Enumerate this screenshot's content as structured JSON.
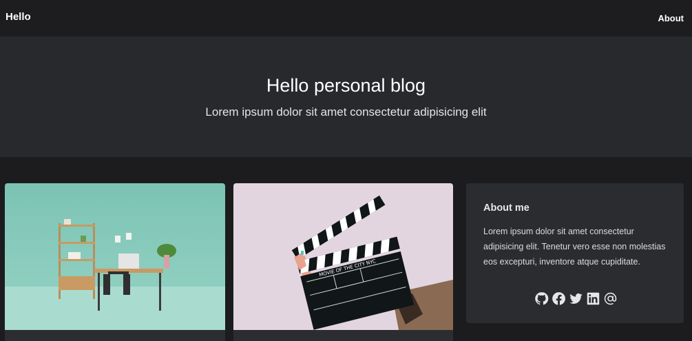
{
  "navbar": {
    "brand": "Hello",
    "about": "About"
  },
  "hero": {
    "title": "Hello personal blog",
    "subtitle": "Lorem ipsum dolor sit amet consectetur adipisicing elit"
  },
  "sidebar": {
    "title": "About me",
    "text": "Lorem ipsum dolor sit amet consectetur adipisicing elit. Tenetur vero esse non molestias eos excepturi, inventore atque cupiditate.",
    "social_icons": [
      "github-icon",
      "facebook-icon",
      "twitter-icon",
      "linkedin-icon",
      "email-icon"
    ]
  },
  "cards": [
    {
      "image": "home-office-desk-photo"
    },
    {
      "image": "film-clapperboard-photo",
      "clapper_text": "MOVIE OF THE CITY NYC"
    }
  ],
  "colors": {
    "page_bg": "#1c1c1f",
    "navbar_bg": "#1d1d20",
    "hero_bg": "#27292c",
    "card_bg": "#2a2c30",
    "text": "#ffffff"
  }
}
